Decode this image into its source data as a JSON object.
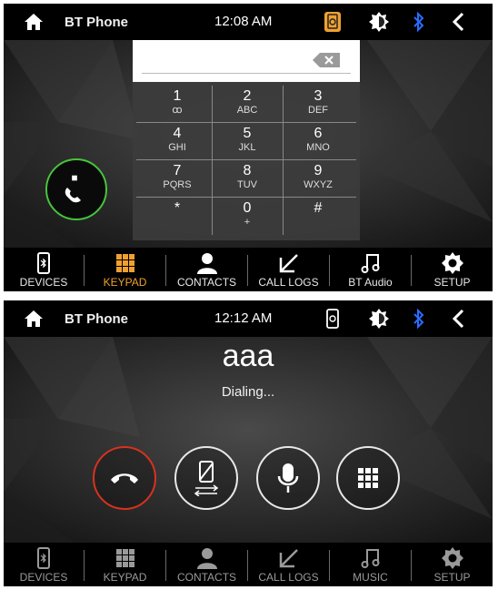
{
  "screen1": {
    "status": {
      "title": "BT Phone",
      "time": "12:08  AM"
    },
    "keypad": {
      "keys": [
        {
          "num": "1",
          "sub": "ꝏ"
        },
        {
          "num": "2",
          "sub": "ABC"
        },
        {
          "num": "3",
          "sub": "DEF"
        },
        {
          "num": "4",
          "sub": "GHI"
        },
        {
          "num": "5",
          "sub": "JKL"
        },
        {
          "num": "6",
          "sub": "MNO"
        },
        {
          "num": "7",
          "sub": "PQRS"
        },
        {
          "num": "8",
          "sub": "TUV"
        },
        {
          "num": "9",
          "sub": "WXYZ"
        },
        {
          "num": "*",
          "sub": ""
        },
        {
          "num": "0",
          "sub": "+"
        },
        {
          "num": "#",
          "sub": ""
        }
      ]
    },
    "nav": [
      {
        "label": "DEVICES",
        "icon": "phone-bluetooth-icon"
      },
      {
        "label": "KEYPAD",
        "icon": "keypad-grid-icon",
        "active": true
      },
      {
        "label": "CONTACTS",
        "icon": "person-icon"
      },
      {
        "label": "CALL LOGS",
        "icon": "arrow-down-left-icon"
      },
      {
        "label": "BT Audio",
        "icon": "music-note-icon"
      },
      {
        "label": "SETUP",
        "icon": "gear-icon"
      }
    ]
  },
  "screen2": {
    "status": {
      "title": "BT Phone",
      "time": "12:12  AM"
    },
    "caller": "aaa",
    "call_status": "Dialing...",
    "nav": [
      {
        "label": "DEVICES",
        "icon": "phone-bluetooth-icon"
      },
      {
        "label": "KEYPAD",
        "icon": "keypad-grid-icon"
      },
      {
        "label": "CONTACTS",
        "icon": "person-icon"
      },
      {
        "label": "CALL LOGS",
        "icon": "arrow-down-left-icon"
      },
      {
        "label": "MUSIC",
        "icon": "music-note-icon"
      },
      {
        "label": "SETUP",
        "icon": "gear-icon"
      }
    ]
  },
  "colors": {
    "accent": "#f0a030",
    "call_green": "#46c43c",
    "hangup_red": "#d8321e",
    "bluetooth": "#2a6cff"
  }
}
